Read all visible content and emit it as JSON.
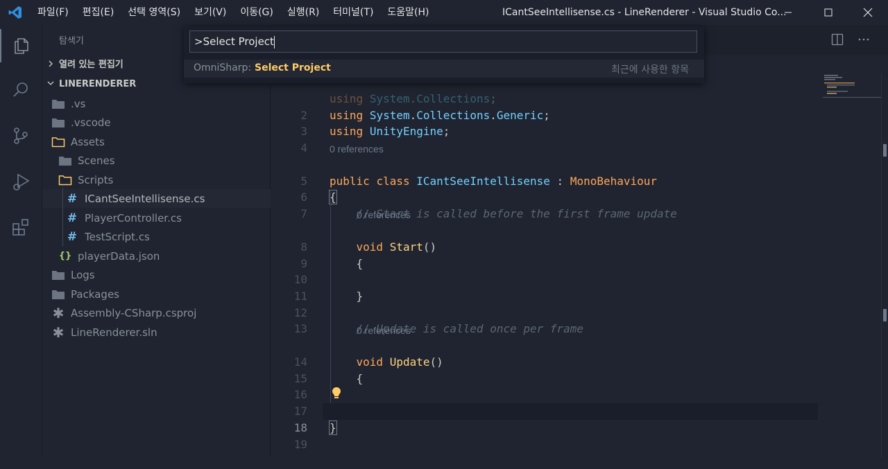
{
  "titlebar": {
    "menus": [
      "파일(F)",
      "편집(E)",
      "선택 영역(S)",
      "보기(V)",
      "이동(G)",
      "실행(R)",
      "터미널(T)",
      "도움말(H)"
    ],
    "window_title": "ICantSeeIntellisense.cs - LineRenderer - Visual Studio Co..."
  },
  "sidebar": {
    "title": "탐색기",
    "open_editors": "열려 있는 편집기",
    "project": "LINERENDERER",
    "tree": [
      {
        "label": ".vs",
        "icon": "folder-icon"
      },
      {
        "label": ".vscode",
        "icon": "folder-icon"
      },
      {
        "label": "Assets",
        "icon": "folder-open-icon"
      },
      {
        "label": "Scenes",
        "icon": "folder-icon"
      },
      {
        "label": "Scripts",
        "icon": "folder-open-icon"
      },
      {
        "label": "ICantSeeIntellisense.cs",
        "icon": "csharp-icon"
      },
      {
        "label": "PlayerController.cs",
        "icon": "csharp-icon"
      },
      {
        "label": "TestScript.cs",
        "icon": "csharp-icon"
      },
      {
        "label": "playerData.json",
        "icon": "json-icon"
      },
      {
        "label": "Logs",
        "icon": "folder-icon"
      },
      {
        "label": "Packages",
        "icon": "folder-icon"
      },
      {
        "label": "Assembly-CSharp.csproj",
        "icon": "asterisk-icon"
      },
      {
        "label": "LineRenderer.sln",
        "icon": "asterisk-icon"
      }
    ]
  },
  "palette": {
    "input_value": ">Select Project",
    "item_prefix": "OmniSharp: ",
    "item_label": "Select Project",
    "item_hint": "최근에 사용한 항목"
  },
  "editor": {
    "lines": [
      {
        "n": "",
        "text": "using System.Collections;"
      },
      {
        "n": "2",
        "text": "using System.Collections.Generic;"
      },
      {
        "n": "3",
        "text": "using UnityEngine;"
      },
      {
        "n": "4",
        "text": ""
      },
      {
        "n": "5",
        "text": "public class ICantSeeIntellisense : MonoBehaviour"
      },
      {
        "n": "6",
        "text": "{"
      },
      {
        "n": "7",
        "text": "    // Start is called before the first frame update"
      },
      {
        "n": "8",
        "text": "    void Start()"
      },
      {
        "n": "9",
        "text": "    {"
      },
      {
        "n": "10",
        "text": ""
      },
      {
        "n": "11",
        "text": "    }"
      },
      {
        "n": "12",
        "text": ""
      },
      {
        "n": "13",
        "text": "    // Update is called once per frame"
      },
      {
        "n": "14",
        "text": "    void Update()"
      },
      {
        "n": "15",
        "text": "    {"
      },
      {
        "n": "16",
        "text": ""
      },
      {
        "n": "17",
        "text": "    }"
      },
      {
        "n": "18",
        "text": "}"
      },
      {
        "n": "19",
        "text": ""
      }
    ],
    "codelens": "0 references"
  },
  "colors": {
    "background": "#1f2430",
    "keyword": "#ffa759",
    "type": "#73d0ff",
    "function": "#ffd580",
    "comment": "#5c6773",
    "accent": "#ffcc66"
  }
}
